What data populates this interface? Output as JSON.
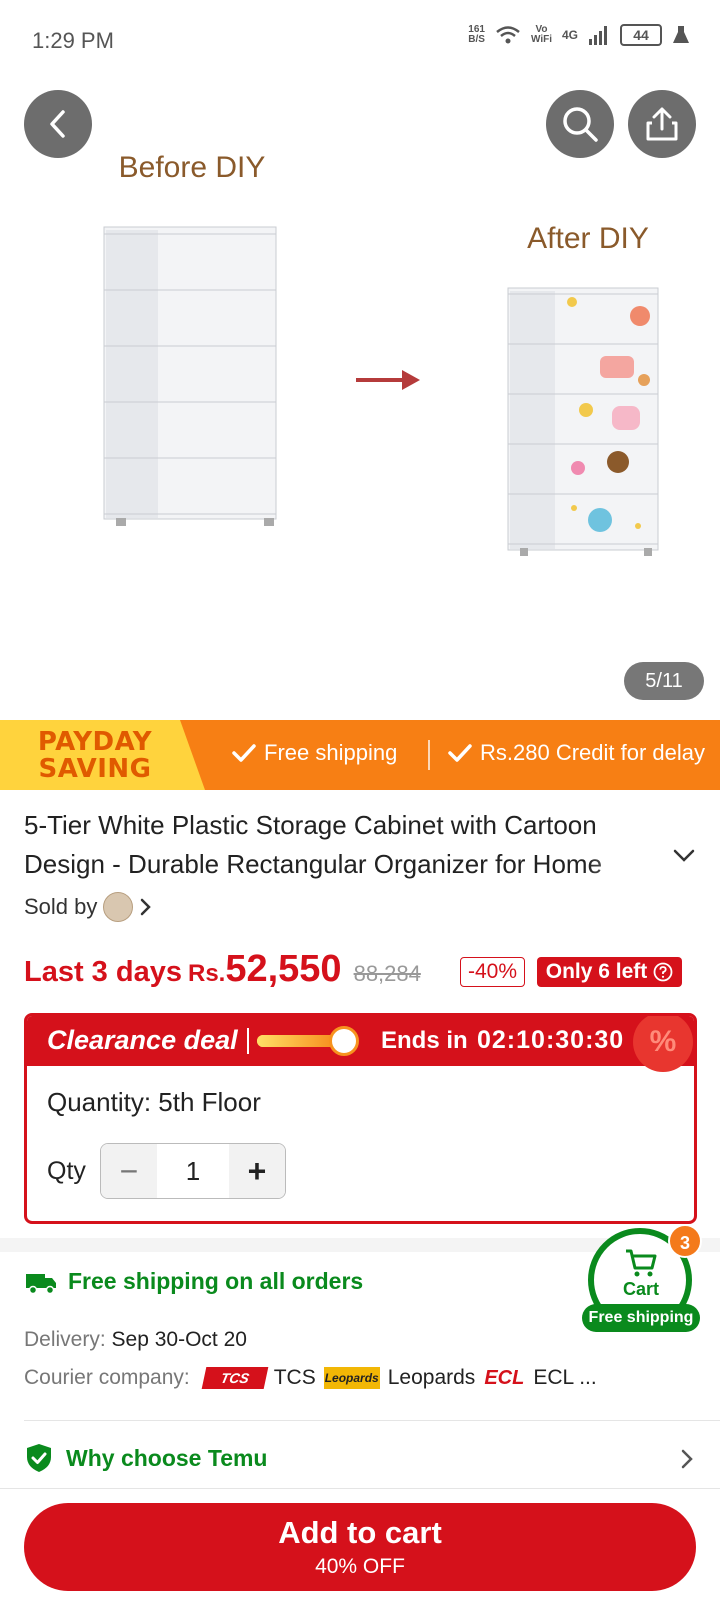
{
  "status_bar": {
    "time": "1:29 PM",
    "net_speed_value": "161",
    "net_speed_unit": "B/S",
    "vowifi_top": "Vo",
    "vowifi_bottom": "WiFi",
    "network": "4G",
    "battery": "44"
  },
  "gallery": {
    "before_label": "Before DIY",
    "after_label": "After DIY",
    "counter": "5/11"
  },
  "promo": {
    "title_line1": "PAYDAY",
    "title_line2": "SAVING",
    "item1": "Free shipping",
    "item2": "Rs.280 Credit for delay"
  },
  "product": {
    "title_line1": "5-Tier White Plastic Storage Cabinet with Cartoon",
    "title_line2": "Design - Durable Rectangular Organizer for Home",
    "sold_by": "Sold by"
  },
  "price": {
    "prefix": "Last 3 days",
    "currency": "Rs.",
    "value": "52,550",
    "original": "88,284",
    "discount": "-40%",
    "stock": "Only 6 left"
  },
  "deal": {
    "title": "Clearance deal",
    "ends_label": "Ends in",
    "timer": "02:10:30:30",
    "progress": 0.85,
    "percent_icon": "%",
    "quantity_label": "Quantity: 5th Floor",
    "qty_label": "Qty",
    "qty_minus": "−",
    "qty_plus": "+",
    "qty_value": "1"
  },
  "shipping": {
    "free_shipping": "Free shipping on all orders",
    "delivery_label": "Delivery:",
    "delivery_value": "Sep 30-Oct 20",
    "courier_label": "Courier company:",
    "couriers": [
      {
        "logo": "TCS",
        "name": "TCS"
      },
      {
        "logo": "Leopards",
        "name": "Leopards"
      },
      {
        "logo": "ECL",
        "name": "ECL ..."
      }
    ]
  },
  "cart": {
    "label": "Cart",
    "badge": "3",
    "free_shipping": "Free shipping"
  },
  "why": {
    "label": "Why choose Temu"
  },
  "add_to_cart": {
    "label": "Add to cart",
    "sub": "40% OFF"
  },
  "colors": {
    "brand_red": "#d5111b",
    "promo_orange": "#f77f14",
    "promo_yellow": "#ffd33d",
    "green": "#0a8a1d"
  },
  "icons": [
    "back-icon",
    "search-icon",
    "share-icon",
    "check-icon",
    "chevron-down-icon",
    "chevron-right-icon",
    "question-icon",
    "truck-icon",
    "shield-check-icon",
    "cart-icon",
    "clock-icon"
  ]
}
